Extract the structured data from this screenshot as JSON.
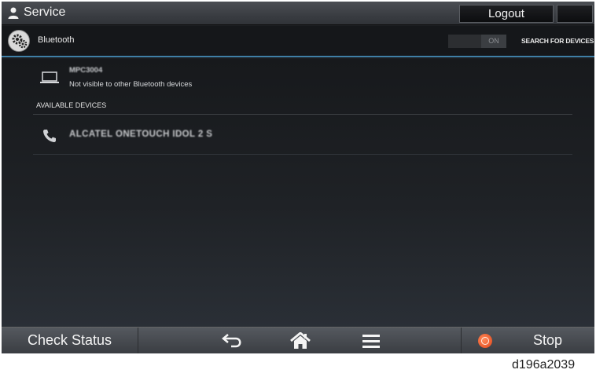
{
  "header": {
    "user_label": "Service",
    "logout_label": "Logout",
    "icons": {
      "user": "person-icon",
      "night_mode": "moon-icon"
    }
  },
  "subheader": {
    "title": "Bluetooth",
    "toggle_state": "ON",
    "search_label": "SEARCH FOR DEVICES",
    "icons": {
      "settings": "gear-icon"
    },
    "accent_color": "#3f7fa6"
  },
  "content": {
    "this_device": {
      "name": "MPC3004",
      "visibility": "Not visible to other Bluetooth devices",
      "icon": "laptop-icon"
    },
    "available_header": "AVAILABLE DEVICES",
    "devices": [
      {
        "name": "ALCATEL ONETOUCH IDOL 2 S",
        "icon": "phone-icon"
      }
    ]
  },
  "bottombar": {
    "check_status_label": "Check Status",
    "stop_label": "Stop",
    "icons": {
      "back": "back-arrow-icon",
      "home": "home-icon",
      "menu": "menu-icon",
      "stop": "stop-icon"
    },
    "stop_color": "#e0461a"
  },
  "caption": "d196a2039"
}
